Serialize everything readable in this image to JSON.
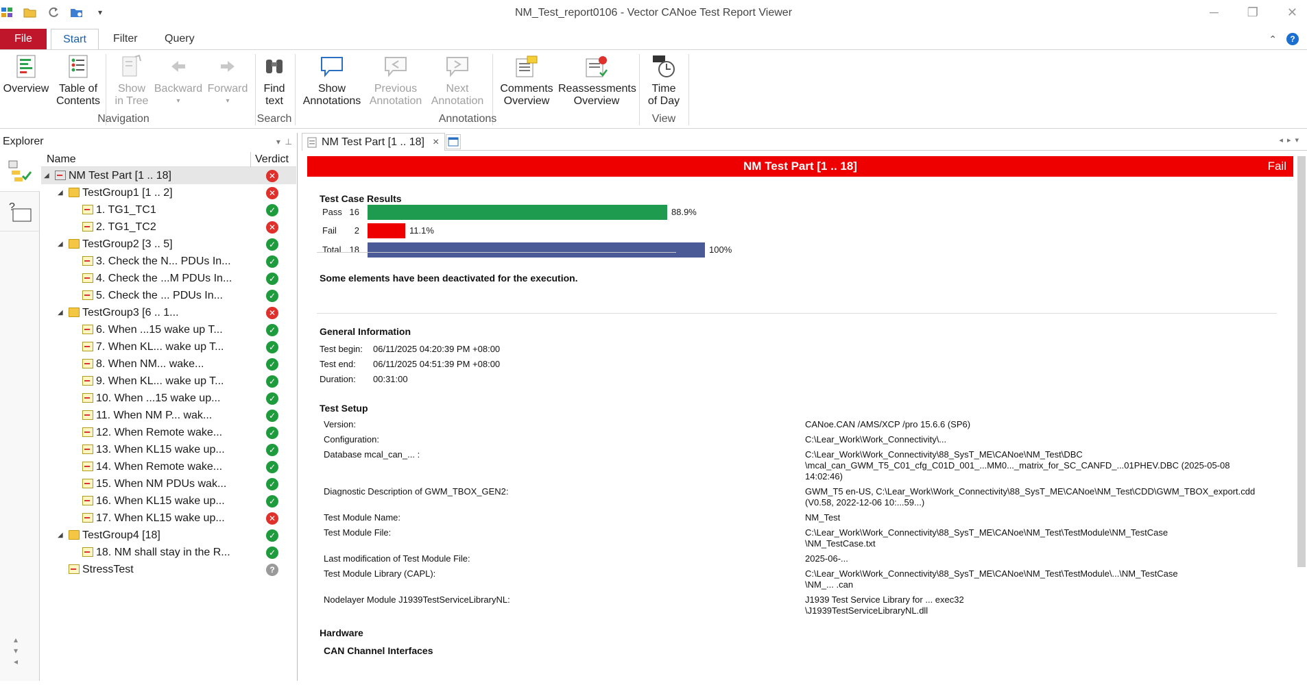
{
  "window": {
    "title": "NM_Test_report0106 - Vector CANoe Test Report Viewer"
  },
  "ribbon_tabs": [
    "File",
    "Start",
    "Filter",
    "Query"
  ],
  "ribbon": {
    "overview": "Overview",
    "toc_1": "Table of",
    "toc_2": "Contents",
    "show_1": "Show",
    "show_2": "in Tree",
    "backward": "Backward",
    "forward": "Forward",
    "find_1": "Find",
    "find_2": "text",
    "show_ann_1": "Show",
    "show_ann_2": "Annotations",
    "prev_ann_1": "Previous",
    "prev_ann_2": "Annotation",
    "next_ann_1": "Next",
    "next_ann_2": "Annotation",
    "comments_1": "Comments",
    "comments_2": "Overview",
    "reass_1": "Reassessments",
    "reass_2": "Overview",
    "time_1": "Time",
    "time_2": "of Day",
    "groups": {
      "navigation": "Navigation",
      "search": "Search",
      "annotations": "Annotations",
      "view": "View"
    }
  },
  "explorer": {
    "title": "Explorer",
    "col_name": "Name",
    "col_verdict": "Verdict",
    "rows": [
      {
        "label": "NM Test Part [1 .. 18]",
        "verdict": "fail"
      },
      {
        "label": "TestGroup1 [1 .. 2]",
        "verdict": "fail"
      },
      {
        "label": "1. TG1_TC1",
        "verdict": "pass"
      },
      {
        "label": "2. TG1_TC2",
        "verdict": "fail"
      },
      {
        "label": "TestGroup2 [3 .. 5]",
        "verdict": "pass"
      },
      {
        "label": "3. Check the N... PDUs In...",
        "verdict": "pass"
      },
      {
        "label": "4. Check the ...M PDUs In...",
        "verdict": "pass"
      },
      {
        "label": "5. Check the ... PDUs In...",
        "verdict": "pass"
      },
      {
        "label": "TestGroup3 [6 .. 1...",
        "verdict": "fail"
      },
      {
        "label": "6. When ...15 wake up T...",
        "verdict": "pass"
      },
      {
        "label": "7. When KL... wake up T...",
        "verdict": "pass"
      },
      {
        "label": "8. When NM... wake...",
        "verdict": "pass"
      },
      {
        "label": "9. When KL... wake up T...",
        "verdict": "pass"
      },
      {
        "label": "10. When ...15 wake up...",
        "verdict": "pass"
      },
      {
        "label": "11. When NM P... wak...",
        "verdict": "pass"
      },
      {
        "label": "12. When Remote wake...",
        "verdict": "pass"
      },
      {
        "label": "13. When KL15 wake up...",
        "verdict": "pass"
      },
      {
        "label": "14. When Remote wake...",
        "verdict": "pass"
      },
      {
        "label": "15. When NM PDUs wak...",
        "verdict": "pass"
      },
      {
        "label": "16. When KL15 wake up...",
        "verdict": "pass"
      },
      {
        "label": "17. When KL15 wake up...",
        "verdict": "fail"
      },
      {
        "label": "TestGroup4 [18]",
        "verdict": "pass"
      },
      {
        "label": "18. NM shall stay in the R...",
        "verdict": "pass"
      },
      {
        "label": "StressTest",
        "verdict": "na"
      }
    ]
  },
  "doc_tab": {
    "label": "NM Test Part [1 .. 18]",
    "close": "×"
  },
  "report": {
    "banner_title": "NM Test Part [1 .. 18]",
    "banner_verdict": "Fail",
    "results_title": "Test Case Results",
    "results": [
      {
        "label": "Pass",
        "count": "16",
        "percent_label": "88.9%",
        "fraction": 0.889,
        "color": "#1e9b4f"
      },
      {
        "label": "Fail",
        "count": "2",
        "percent_label": "11.1%",
        "fraction": 0.111,
        "color": "#ee0000"
      },
      {
        "label": "Total",
        "count": "18",
        "percent_label": "100%",
        "fraction": 1.0,
        "color": "#4a5a96"
      }
    ],
    "deactivated_note": "Some elements have been deactivated for the execution.",
    "general_title": "General Information",
    "general": {
      "begin_label": "Test begin:",
      "begin_value": "06/11/2025 04:20:39 PM +08:00",
      "end_label": "Test end:",
      "end_value": "06/11/2025 04:51:39 PM +08:00",
      "duration_label": "Duration:",
      "duration_value": "00:31:00"
    },
    "setup_title": "Test Setup",
    "setup": {
      "version_label": "Version:",
      "version_value": "CANoe.CAN /AMS/XCP /pro 15.6.6 (SP6)",
      "config_label": "Configuration:",
      "config_value": "C:\\Lear_Work\\Work_Connectivity\\...",
      "db_label": "Database mcal_can_... :",
      "db_value_1": "C:\\Lear_Work\\Work_Connectivity\\88_SysT_ME\\CANoe\\NM_Test\\DBC",
      "db_value_2": "\\mcal_can_GWM_T5_C01_cfg_C01D_001_...MM0..._matrix_for_SC_CANFD_...01PHEV.DBC (2025-05-08",
      "db_value_3": "14:02:46)",
      "diag_label": "Diagnostic Description of GWM_TBOX_GEN2:",
      "diag_value_1": "GWM_T5 en-US, C:\\Lear_Work\\Work_Connectivity\\88_SysT_ME\\CANoe\\NM_Test\\CDD\\GWM_TBOX_export.cdd",
      "diag_value_2": "(V0.58, 2022-12-06 10:...59...)",
      "module_name_label": "Test Module Name:",
      "module_name_value": "NM_Test",
      "module_file_label": "Test Module File:",
      "module_file_value_1": "C:\\Lear_Work\\Work_Connectivity\\88_SysT_ME\\CANoe\\NM_Test\\TestModule\\NM_TestCase",
      "module_file_value_2": "\\NM_TestCase.txt",
      "last_mod_label": "Last modification of Test Module File:",
      "last_mod_value": "2025-06-...",
      "capl_label": "Test Module Library (CAPL):",
      "capl_value_1": "C:\\Lear_Work\\Work_Connectivity\\88_SysT_ME\\CANoe\\NM_Test\\TestModule\\...\\NM_TestCase",
      "capl_value_2": "\\NM_... .can",
      "nodelayer_label": "Nodelayer Module J1939TestServiceLibraryNL:",
      "nodelayer_value_1": "J1939 Test Service Library for ... exec32",
      "nodelayer_value_2": "\\J1939TestServiceLibraryNL.dll"
    },
    "hardware_title": "Hardware",
    "can_title": "CAN Channel Interfaces"
  }
}
